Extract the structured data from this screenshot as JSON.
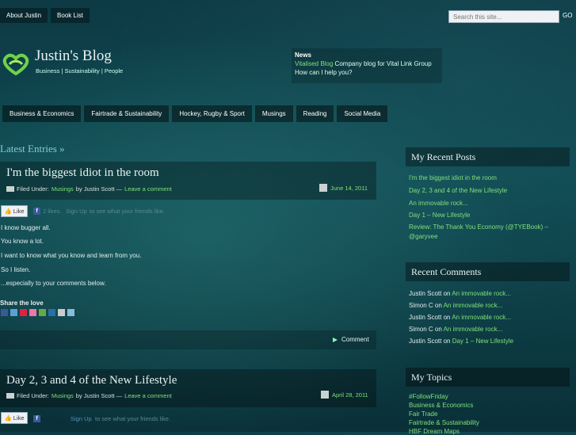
{
  "top_nav": [
    {
      "label": "About Justin"
    },
    {
      "label": "Book List"
    }
  ],
  "search": {
    "placeholder": "Search this site...",
    "go": "GO"
  },
  "site": {
    "title": "Justin's Blog",
    "tagline": "Business | Sustainability | People"
  },
  "news": {
    "heading": "News",
    "link": "Vitalised Blog",
    "text": " Company blog for Vital Link Group",
    "line2": "How can I help you?"
  },
  "cat_nav": [
    {
      "label": "Business & Economics"
    },
    {
      "label": "Fairtrade & Sustainability"
    },
    {
      "label": "Hockey, Rugby & Sport"
    },
    {
      "label": "Musings"
    },
    {
      "label": "Reading"
    },
    {
      "label": "Social Media"
    }
  ],
  "latest_heading": "Latest Entries »",
  "posts": [
    {
      "title": "I'm the biggest idiot in the room",
      "filed_under": "Filed Under:",
      "category": "Musings",
      "by": "by Justin Scott —",
      "comment_link": "Leave a comment",
      "date": "June 14, 2011",
      "like": "Like",
      "likes_text": "2 likes.",
      "signup": "Sign Up",
      "signup_rest": "to see what your friends like.",
      "paragraphs": [
        "I know bugger all.",
        "You know a lot.",
        "I want to know what you know and learn from you.",
        "So I listen.",
        "...especially to your comments below."
      ],
      "share_title": "Share the love",
      "comment": "Comment"
    },
    {
      "title": "Day 2, 3 and 4 of the New Lifestyle",
      "filed_under": "Filed Under:",
      "category": "Musings",
      "by": "by Justin Scott —",
      "comment_link": "Leave a comment",
      "date": "April 28, 2011",
      "like": "Like",
      "signup": "Sign Up",
      "signup_rest": "to see what your friends like."
    }
  ],
  "sidebar": {
    "recent_posts": {
      "title": "My Recent Posts",
      "items": [
        "I'm the biggest idiot in the room",
        "Day 2, 3 and 4 of the New Lifestyle",
        "An immovable rock...",
        "Day 1 – New Lifestyle",
        "Review: The Thank You Economy (@TYEBook) –",
        "@garyvee"
      ]
    },
    "recent_comments": {
      "title": "Recent Comments",
      "items": [
        {
          "author": "Justin Scott",
          "on": " on ",
          "post": "An immovable rock..."
        },
        {
          "author": "Simon C",
          "on": " on ",
          "post": "An immovable rock..."
        },
        {
          "author": "Justin Scott",
          "on": " on ",
          "post": "An immovable rock..."
        },
        {
          "author": "Simon C",
          "on": " on ",
          "post": "An immovable rock..."
        },
        {
          "author": "Justin Scott",
          "on": " on ",
          "post": "Day 1 – New Lifestyle"
        }
      ]
    },
    "topics": {
      "title": "My Topics",
      "items": [
        "#FollowFriday",
        "Business & Economics",
        "Fair Trade",
        "Fairtrade & Sustainability",
        "HBF Dream Maps"
      ]
    }
  },
  "colors": {
    "accent": "#7fe07a",
    "background": "#0d3a44"
  }
}
